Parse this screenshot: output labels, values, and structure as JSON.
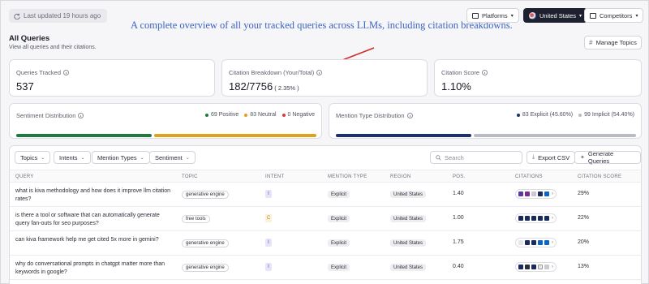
{
  "header": {
    "last_updated": "Last updated 19 hours ago",
    "annotation": "A complete overview of all your tracked queries across LLMs, including citation breakdowns.",
    "platforms_label": "Platforms",
    "country_label": "United States",
    "competitors_label": "Competitors"
  },
  "page": {
    "title": "All Queries",
    "subtitle": "View all queries and their citations.",
    "manage_topics": "Manage Topics"
  },
  "cards": {
    "queries_tracked": {
      "label": "Queries Tracked",
      "value": "537"
    },
    "citation_breakdown": {
      "label": "Citation Breakdown (Your/Total)",
      "value": "182/7756",
      "pct": "( 2.35% )"
    },
    "citation_score": {
      "label": "Citation Score",
      "value": "1.10%"
    }
  },
  "sentiment": {
    "label": "Sentiment Distribution",
    "positive": "69 Positive",
    "neutral": "83 Neutral",
    "negative": "0 Negative",
    "colors": {
      "positive": "#1f7a3f",
      "neutral": "#e0a21a",
      "negative": "#d23c3c"
    },
    "share": {
      "positive": 0.454,
      "neutral": 0.546,
      "negative": 0
    }
  },
  "mention_type": {
    "label": "Mention Type Distribution",
    "explicit": "83 Explicit (45.60%)",
    "implicit": "99 Implicit (54.40%)",
    "colors": {
      "explicit": "#1c2f6e",
      "implicit": "#b9bcc5"
    },
    "share": {
      "explicit": 0.456,
      "implicit": 0.544
    }
  },
  "filters": {
    "topics": "Topics",
    "intents": "Intents",
    "mention_types": "Mention Types",
    "sentiment": "Sentiment",
    "search_placeholder": "Search",
    "export_csv": "Export CSV",
    "generate_queries": "Generate Queries"
  },
  "table": {
    "columns": [
      "QUERY",
      "TOPIC",
      "INTENT",
      "MENTION TYPE",
      "REGION",
      "POS.",
      "CITATIONS",
      "CITATION SCORE"
    ],
    "rows": [
      {
        "query": "what is kiva methodology and how does it improve llm citation rates?",
        "topic": "generative engine",
        "intent": "I",
        "mention": "Explicit",
        "region": "United States",
        "pos": "1.40",
        "score": "29%"
      },
      {
        "query": "is there a tool or software that can automatically generate query fan-outs for seo purposes?",
        "topic": "free tools",
        "intent": "C",
        "mention": "Explicit",
        "region": "United States",
        "pos": "1.00",
        "score": "22%"
      },
      {
        "query": "can kiva framework help me get cited 5x more in gemini?",
        "topic": "generative engine",
        "intent": "I",
        "mention": "Explicit",
        "region": "United States",
        "pos": "1.75",
        "score": "20%"
      },
      {
        "query": "why do conversational prompts in chatgpt matter more than keywords in google?",
        "topic": "generative engine",
        "intent": "I",
        "mention": "Explicit",
        "region": "United States",
        "pos": "0.40",
        "score": "13%"
      }
    ]
  }
}
